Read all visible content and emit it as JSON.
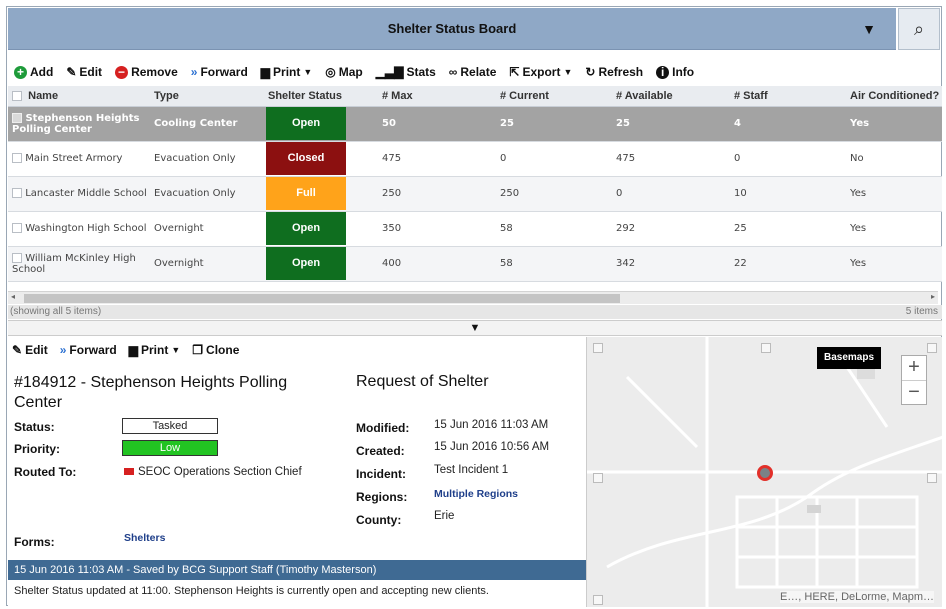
{
  "header": {
    "title": "Shelter Status Board"
  },
  "toolbar": {
    "add": "Add",
    "edit": "Edit",
    "remove": "Remove",
    "forward": "Forward",
    "print": "Print",
    "map": "Map",
    "stats": "Stats",
    "relate": "Relate",
    "export": "Export",
    "refresh": "Refresh",
    "info": "Info"
  },
  "grid": {
    "columns": [
      "Name",
      "Type",
      "Shelter Status",
      "# Max",
      "# Current",
      "# Available",
      "# Staff",
      "Air Conditioned?"
    ],
    "rows": [
      {
        "name": "Stephenson Heights Polling Center",
        "type": "Cooling Center",
        "status": "Open",
        "status_color": "#0f6e1f",
        "max": "50",
        "current": "25",
        "available": "25",
        "staff": "4",
        "ac": "Yes"
      },
      {
        "name": "Main Street Armory",
        "type": "Evacuation Only",
        "status": "Closed",
        "status_color": "#8c1010",
        "max": "475",
        "current": "0",
        "available": "475",
        "staff": "0",
        "ac": "No"
      },
      {
        "name": "Lancaster Middle School",
        "type": "Evacuation Only",
        "status": "Full",
        "status_color": "#ffa31a",
        "max": "250",
        "current": "250",
        "available": "0",
        "staff": "10",
        "ac": "Yes"
      },
      {
        "name": "Washington High School",
        "type": "Overnight",
        "status": "Open",
        "status_color": "#0f6e1f",
        "max": "350",
        "current": "58",
        "available": "292",
        "staff": "25",
        "ac": "Yes"
      },
      {
        "name": "William McKinley High School",
        "type": "Overnight",
        "status": "Open",
        "status_color": "#0f6e1f",
        "max": "400",
        "current": "58",
        "available": "342",
        "staff": "22",
        "ac": "Yes"
      }
    ],
    "footer_left": "(showing all 5 items)",
    "footer_right": "5 items"
  },
  "detail": {
    "toolbar": {
      "edit": "Edit",
      "forward": "Forward",
      "print": "Print",
      "clone": "Clone"
    },
    "record_title": "#184912 - Stephenson Heights Polling Center",
    "record_type": "Request of Shelter",
    "labels": {
      "status": "Status:",
      "priority": "Priority:",
      "routed_to": "Routed To:",
      "forms": "Forms:",
      "modified": "Modified:",
      "created": "Created:",
      "incident": "Incident:",
      "regions": "Regions:",
      "county": "County:"
    },
    "status": "Tasked",
    "priority": "Low",
    "routed_to": "SEOC Operations Section Chief",
    "forms": "Shelters",
    "modified": "15 Jun 2016 11:03 AM",
    "created": "15 Jun 2016 10:56 AM",
    "incident": "Test Incident 1",
    "regions": "Multiple Regions",
    "county": "Erie",
    "log_header": "15 Jun 2016 11:03 AM - Saved by BCG Support Staff (Timothy Masterson)",
    "log_text": "Shelter Status updated at 11:00.  Stephenson Heights is currently open and accepting new clients."
  },
  "map": {
    "basemaps": "Basemaps",
    "zoom_in": "+",
    "zoom_out": "−",
    "attribution": "E…, HERE, DeLorme, Mapm…"
  }
}
